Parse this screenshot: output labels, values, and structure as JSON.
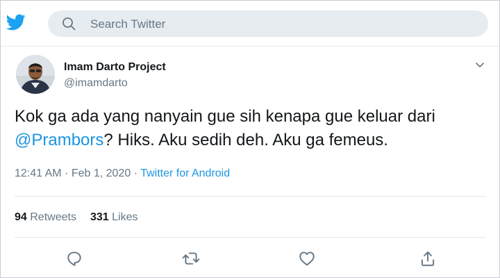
{
  "header": {
    "logo_icon": "twitter-bird-icon",
    "search_icon": "search-icon",
    "search_placeholder": "Search Twitter"
  },
  "tweet": {
    "author_name": "Imam Darto Project",
    "author_handle": "@imamdarto",
    "text_before": "Kok ga ada yang nanyain gue sih kenapa gue keluar dari ",
    "mention": "@Prambors",
    "text_after": "? Hiks. Aku sedih deh. Aku ga femeus.",
    "time": "12:41 AM",
    "date": "Feb 1, 2020",
    "source": "Twitter for Android",
    "retweets_count": "94",
    "retweets_label": "Retweets",
    "likes_count": "331",
    "likes_label": "Likes"
  },
  "actions": [
    "reply-icon",
    "retweet-icon",
    "like-icon",
    "share-icon"
  ],
  "colors": {
    "brand": "#1da1f2",
    "link": "#1b95e0",
    "muted": "#657786",
    "search_bg": "#e6ecf0"
  }
}
